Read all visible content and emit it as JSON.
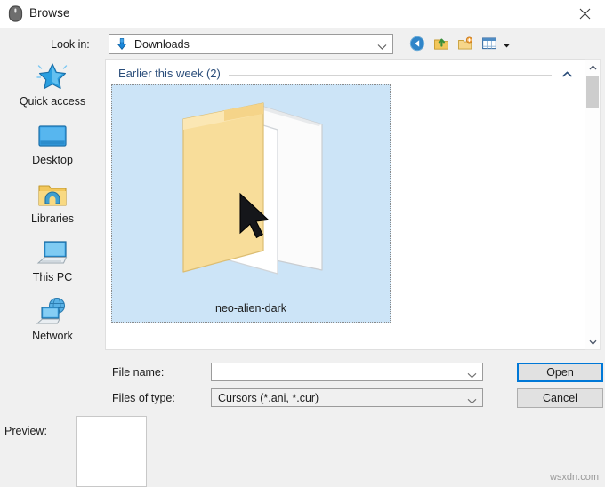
{
  "window": {
    "title": "Browse",
    "title_icon": "mouse-icon",
    "close_icon": "close-icon"
  },
  "lookin": {
    "label": "Look in:",
    "value": "Downloads",
    "icon": "downloads-arrow-icon",
    "chevron": "chevron-down-icon"
  },
  "toolbar": {
    "buttons": [
      {
        "name": "back-icon",
        "tooltip": "Back"
      },
      {
        "name": "up-one-level-icon",
        "tooltip": "Up one level"
      },
      {
        "name": "new-folder-icon",
        "tooltip": "Create New Folder"
      },
      {
        "name": "views-icon",
        "tooltip": "Views"
      }
    ],
    "views_caret": "caret-down-icon"
  },
  "places": [
    {
      "label": "Quick access",
      "icon": "star-icon"
    },
    {
      "label": "Desktop",
      "icon": "desktop-icon"
    },
    {
      "label": "Libraries",
      "icon": "libraries-folder-icon"
    },
    {
      "label": "This PC",
      "icon": "computer-icon"
    },
    {
      "label": "Network",
      "icon": "network-globe-icon"
    }
  ],
  "filelist": {
    "group": {
      "label": "Earlier this week (2)",
      "collapse_icon": "chevron-up-icon"
    },
    "items": [
      {
        "name": "neo-alien-dark",
        "icon": "open-folder-cursor-thumbnail",
        "selected": true
      }
    ]
  },
  "scrollbar": {
    "up_icon": "scroll-up-arrow-icon",
    "down_icon": "scroll-down-arrow-icon",
    "thumb": "scrollbar-thumb"
  },
  "fields": {
    "filename_label": "File name:",
    "filename_value": "",
    "filename_placeholder": "",
    "filetype_label": "Files of type:",
    "filetype_value": "Cursors (*.ani, *.cur)",
    "chevron": "chevron-down-icon"
  },
  "buttons": {
    "open": "Open",
    "cancel": "Cancel"
  },
  "preview": {
    "label": "Preview:",
    "content": ""
  },
  "watermark": "wsxdn.com",
  "colors": {
    "accent": "#0078d7",
    "selection": "#cce4f7",
    "group_header_text": "#2a4d7a",
    "dialog_bg": "#f0f0f0",
    "panel_bg": "#ffffff"
  }
}
